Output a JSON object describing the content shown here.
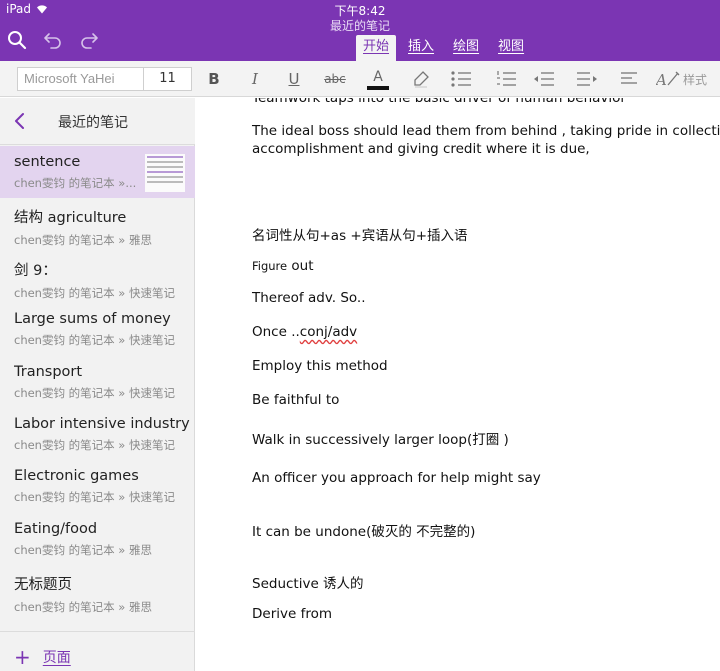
{
  "status": {
    "device": "iPad",
    "time": "下午8:42"
  },
  "app": {
    "title": "最近的笔记"
  },
  "tabs": [
    {
      "label": "开始",
      "active": true
    },
    {
      "label": "插入",
      "active": false
    },
    {
      "label": "绘图",
      "active": false
    },
    {
      "label": "视图",
      "active": false
    }
  ],
  "toolbar": {
    "font_name": "Microsoft YaHei",
    "font_size": "11",
    "bold_label": "B",
    "italic_label": "I",
    "underline_label": "U",
    "strike_label": "abc",
    "font_color_label": "A",
    "styles_label": "样式"
  },
  "sidebar": {
    "title": "最近的笔记",
    "notes": [
      {
        "title": "sentence",
        "sub": "chen雯钧 的笔记本 »..."
      },
      {
        "title": "结构 agriculture",
        "sub": "chen雯钧 的笔记本 » 雅思"
      },
      {
        "title": "剑 9：",
        "sub": "chen雯钧 的笔记本 » 快速笔记"
      },
      {
        "title": "Large sums of money",
        "sub": "chen雯钧 的笔记本 » 快速笔记"
      },
      {
        "title": "Transport",
        "sub": "chen雯钧 的笔记本 » 快速笔记"
      },
      {
        "title": "Labor intensive industry",
        "sub": "chen雯钧 的笔记本 » 快速笔记"
      },
      {
        "title": "Electronic games",
        "sub": "chen雯钧 的笔记本 » 快速笔记"
      },
      {
        "title": "Eating/food",
        "sub": "chen雯钧 的笔记本 » 雅思"
      },
      {
        "title": "无标题页",
        "sub": "chen雯钧 的笔记本 » 雅思"
      }
    ],
    "add_page_label": "页面"
  },
  "content": {
    "partial_top": "Teamwork taps into the basic driver of human behavior",
    "para1_line1": "The ideal boss should lead them from behind , taking pride in collective",
    "para1_line2": "accomplishment and giving credit where it is due,",
    "grammar": "名词性从句+as +宾语从句+插入语",
    "figure_word": "Figure",
    "figure_rest": " out",
    "thereof": "Thereof adv. So..",
    "once_prefix": "Once ..",
    "once_marked": "conj/adv",
    "employ": "Employ this method",
    "faithful": "Be faithful to",
    "walk": "Walk in successively larger loop(打圈 )",
    "officer": "An officer you approach for help might say",
    "undone": "It can be undone(破灭的 不完整的)",
    "seductive": "Seductive 诱人的",
    "derive": "Derive from"
  }
}
